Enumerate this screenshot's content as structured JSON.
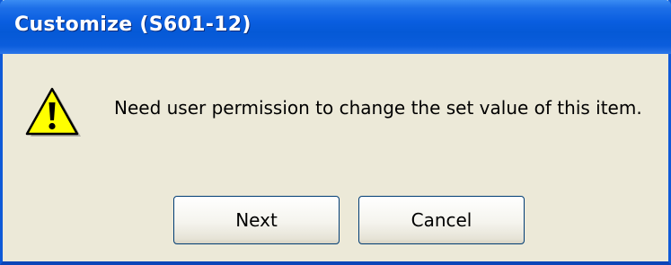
{
  "window": {
    "title": "Customize (S601-12)"
  },
  "dialog": {
    "icon": "warning-icon",
    "message": "Need user permission to change the set value of this item."
  },
  "buttons": {
    "next_label": "Next",
    "cancel_label": "Cancel"
  },
  "colors": {
    "titlebar": "#0559d6",
    "dialog_background": "#ece9d8",
    "icon_fill": "#ffff00",
    "button_border": "#003c74"
  }
}
